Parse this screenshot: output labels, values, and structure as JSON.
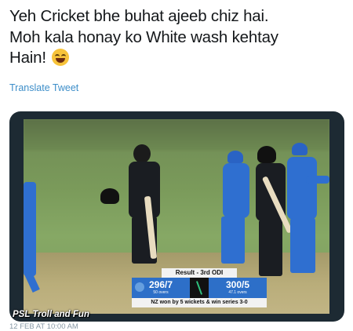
{
  "tweet": {
    "line1": "Yeh Cricket bhe buhat ajeeb chiz hai.",
    "line2": "Moh kala honay ko White wash kehtay",
    "line3": "Hain!",
    "emoji": "face-with-tears-of-joy-icon",
    "translate_label": "Translate Tweet",
    "timestamp": "12 FEB AT 10:00 AM"
  },
  "image": {
    "scorecard": {
      "title": "Result - 3rd ODI",
      "team1_score": "296/7",
      "team1_overs": "50 overs",
      "team2_score": "300/5",
      "team2_overs": "47.1 overs",
      "footer": "NZ won by 5 wickets & win series 3-0"
    },
    "watermark": "PSL Troll and Fun"
  },
  "colors": {
    "link": "#3d8ec9",
    "india_blue": "#2f6fd0",
    "nz_black": "#1a1d22"
  }
}
